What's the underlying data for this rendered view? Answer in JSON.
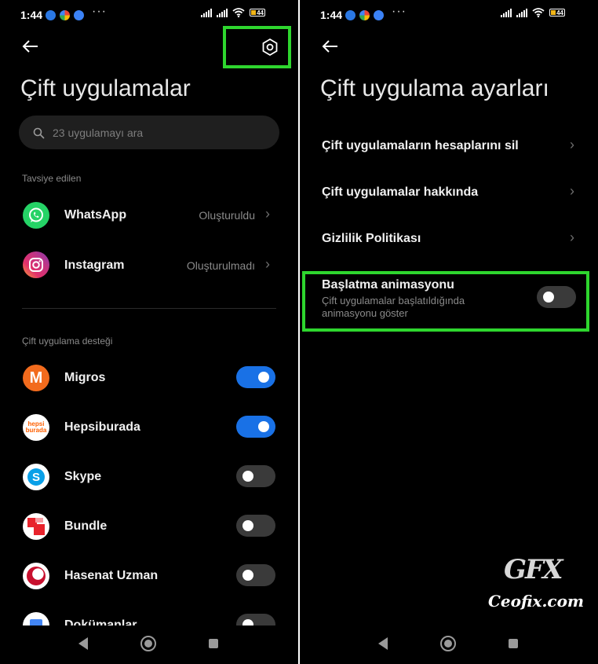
{
  "status_bar": {
    "time": "1:44",
    "battery": "44"
  },
  "left_screen": {
    "title": "Çift uygulamalar",
    "search": {
      "placeholder": "23 uygulamayı ara"
    },
    "recommended": {
      "label": "Tavsiye edilen",
      "items": [
        {
          "name": "WhatsApp",
          "status": "Oluşturuldu"
        },
        {
          "name": "Instagram",
          "status": "Oluşturulmadı"
        }
      ]
    },
    "supported": {
      "label": "Çift uygulama desteği",
      "items": [
        {
          "name": "Migros",
          "enabled": true
        },
        {
          "name": "Hepsiburada",
          "enabled": true
        },
        {
          "name": "Skype",
          "enabled": false
        },
        {
          "name": "Bundle",
          "enabled": false
        },
        {
          "name": "Hasenat Uzman",
          "enabled": false
        },
        {
          "name": "Dokümanlar",
          "enabled": false
        }
      ]
    },
    "hepsiburada_icon_text": [
      "hepsi",
      "burada"
    ]
  },
  "right_screen": {
    "title": "Çift uygulama ayarları",
    "items": [
      {
        "label": "Çift uygulamaların hesaplarını sil"
      },
      {
        "label": "Çift uygulamalar hakkında"
      },
      {
        "label": "Gizlilik Politikası"
      }
    ],
    "animation": {
      "title": "Başlatma animasyonu",
      "subtitle_line1": "Çift uygulamalar başlatıldığında",
      "subtitle_line2": "animasyonu göster",
      "enabled": false
    }
  },
  "watermark": {
    "logo_text": "GFX",
    "site": "Ceofix.com"
  },
  "colors": {
    "highlight": "#2ed62e",
    "toggle_on": "#1971e6",
    "whatsapp": "#25d366"
  }
}
